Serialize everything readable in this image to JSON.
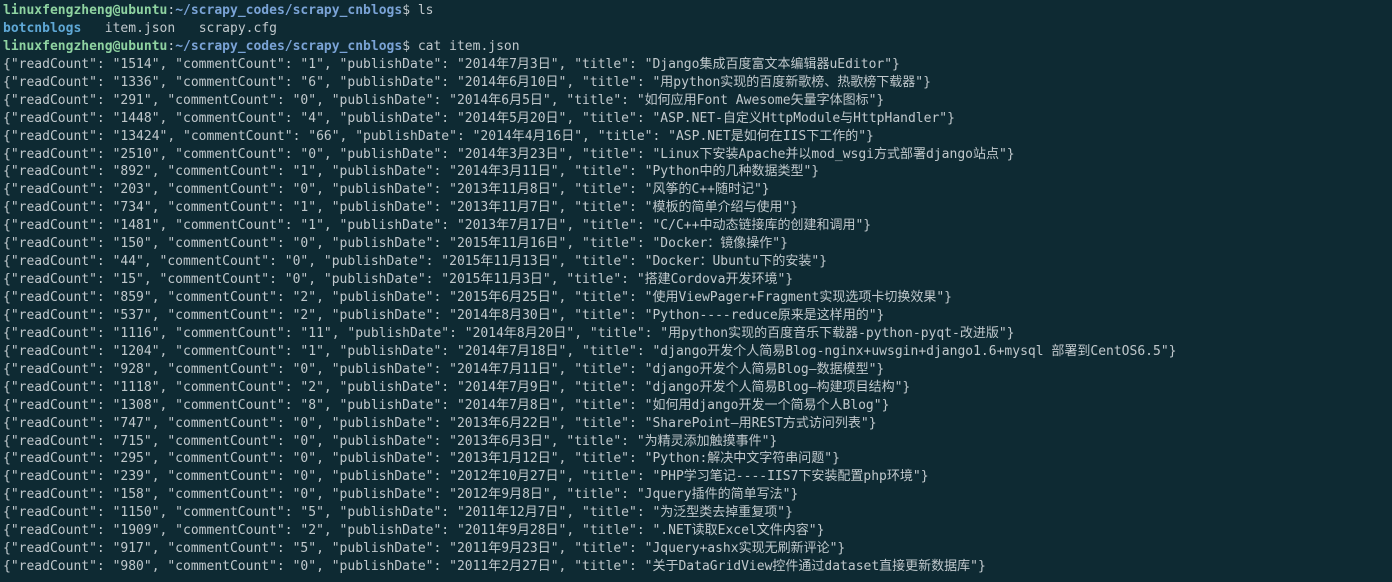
{
  "lines": [
    {
      "type": "prompt",
      "user": "linuxfengzheng",
      "host": "ubuntu",
      "path": "~/scrapy_codes/scrapy_cnblogs",
      "cmd": "ls"
    },
    {
      "type": "ls",
      "entries": [
        {
          "name": "botcnblogs",
          "kind": "dir"
        },
        {
          "name": "item.json",
          "kind": "file"
        },
        {
          "name": "scrapy.cfg",
          "kind": "file"
        }
      ]
    },
    {
      "type": "prompt",
      "user": "linuxfengzheng",
      "host": "ubuntu",
      "path": "~/scrapy_codes/scrapy_cnblogs",
      "cmd": "cat item.json"
    },
    {
      "type": "json",
      "readCount": "1514",
      "commentCount": "1",
      "publishDate": "2014年7月3日",
      "title": "Django集成百度富文本编辑器uEditor"
    },
    {
      "type": "json",
      "readCount": "1336",
      "commentCount": "6",
      "publishDate": "2014年6月10日",
      "title": "用python实现的百度新歌榜、热歌榜下载器"
    },
    {
      "type": "json",
      "readCount": "291",
      "commentCount": "0",
      "publishDate": "2014年6月5日",
      "title": "如何应用Font Awesome矢量字体图标"
    },
    {
      "type": "json",
      "readCount": "1448",
      "commentCount": "4",
      "publishDate": "2014年5月20日",
      "title": "ASP.NET-自定义HttpModule与HttpHandler"
    },
    {
      "type": "json",
      "readCount": "13424",
      "commentCount": "66",
      "publishDate": "2014年4月16日",
      "title": "ASP.NET是如何在IIS下工作的"
    },
    {
      "type": "json",
      "readCount": "2510",
      "commentCount": "0",
      "publishDate": "2014年3月23日",
      "title": "Linux下安装Apache并以mod_wsgi方式部署django站点"
    },
    {
      "type": "json",
      "readCount": "892",
      "commentCount": "1",
      "publishDate": "2014年3月11日",
      "title": "Python中的几种数据类型"
    },
    {
      "type": "json",
      "readCount": "203",
      "commentCount": "0",
      "publishDate": "2013年11月8日",
      "title": "风筝的C++随时记"
    },
    {
      "type": "json",
      "readCount": "734",
      "commentCount": "1",
      "publishDate": "2013年11月7日",
      "title": "模板的简单介绍与使用"
    },
    {
      "type": "json",
      "readCount": "1481",
      "commentCount": "1",
      "publishDate": "2013年7月17日",
      "title": "C/C++中动态链接库的创建和调用"
    },
    {
      "type": "json",
      "readCount": "150",
      "commentCount": "0",
      "publishDate": "2015年11月16日",
      "title": "Docker：镜像操作"
    },
    {
      "type": "json",
      "readCount": "44",
      "commentCount": "0",
      "publishDate": "2015年11月13日",
      "title": "Docker：Ubuntu下的安装"
    },
    {
      "type": "json",
      "readCount": "15",
      "commentCount": "0",
      "publishDate": "2015年11月3日",
      "title": "搭建Cordova开发环境"
    },
    {
      "type": "json",
      "readCount": "859",
      "commentCount": "2",
      "publishDate": "2015年6月25日",
      "title": "使用ViewPager+Fragment实现选项卡切换效果"
    },
    {
      "type": "json",
      "readCount": "537",
      "commentCount": "2",
      "publishDate": "2014年8月30日",
      "title": "Python----reduce原来是这样用的"
    },
    {
      "type": "json",
      "readCount": "1116",
      "commentCount": "11",
      "publishDate": "2014年8月20日",
      "title": "用python实现的百度音乐下载器-python-pyqt-改进版"
    },
    {
      "type": "json",
      "readCount": "1204",
      "commentCount": "1",
      "publishDate": "2014年7月18日",
      "title": "django开发个人简易Blog-nginx+uwsgin+django1.6+mysql 部署到CentOS6.5"
    },
    {
      "type": "json",
      "readCount": "928",
      "commentCount": "0",
      "publishDate": "2014年7月11日",
      "title": "django开发个人简易Blog—数据模型"
    },
    {
      "type": "json",
      "readCount": "1118",
      "commentCount": "2",
      "publishDate": "2014年7月9日",
      "title": "django开发个人简易Blog—构建项目结构"
    },
    {
      "type": "json",
      "readCount": "1308",
      "commentCount": "8",
      "publishDate": "2014年7月8日",
      "title": "如何用django开发一个简易个人Blog"
    },
    {
      "type": "json",
      "readCount": "747",
      "commentCount": "0",
      "publishDate": "2013年6月22日",
      "title": "SharePoint—用REST方式访问列表"
    },
    {
      "type": "json",
      "readCount": "715",
      "commentCount": "0",
      "publishDate": "2013年6月3日",
      "title": "为精灵添加触摸事件"
    },
    {
      "type": "json",
      "readCount": "295",
      "commentCount": "0",
      "publishDate": "2013年1月12日",
      "title": "Python:解决中文字符串问题"
    },
    {
      "type": "json",
      "readCount": "239",
      "commentCount": "0",
      "publishDate": "2012年10月27日",
      "title": "PHP学习笔记----IIS7下安装配置php环境"
    },
    {
      "type": "json",
      "readCount": "158",
      "commentCount": "0",
      "publishDate": "2012年9月8日",
      "title": "Jquery插件的简单写法"
    },
    {
      "type": "json",
      "readCount": "1150",
      "commentCount": "5",
      "publishDate": "2011年12月7日",
      "title": "为泛型类去掉重复项"
    },
    {
      "type": "json",
      "readCount": "1909",
      "commentCount": "2",
      "publishDate": "2011年9月28日",
      "title": ".NET读取Excel文件内容"
    },
    {
      "type": "json",
      "readCount": "917",
      "commentCount": "5",
      "publishDate": "2011年9月23日",
      "title": "Jquery+ashx实现无刷新评论"
    },
    {
      "type": "json",
      "readCount": "980",
      "commentCount": "0",
      "publishDate": "2011年2月27日",
      "title": "关于DataGridView控件通过dataset直接更新数据库"
    }
  ]
}
